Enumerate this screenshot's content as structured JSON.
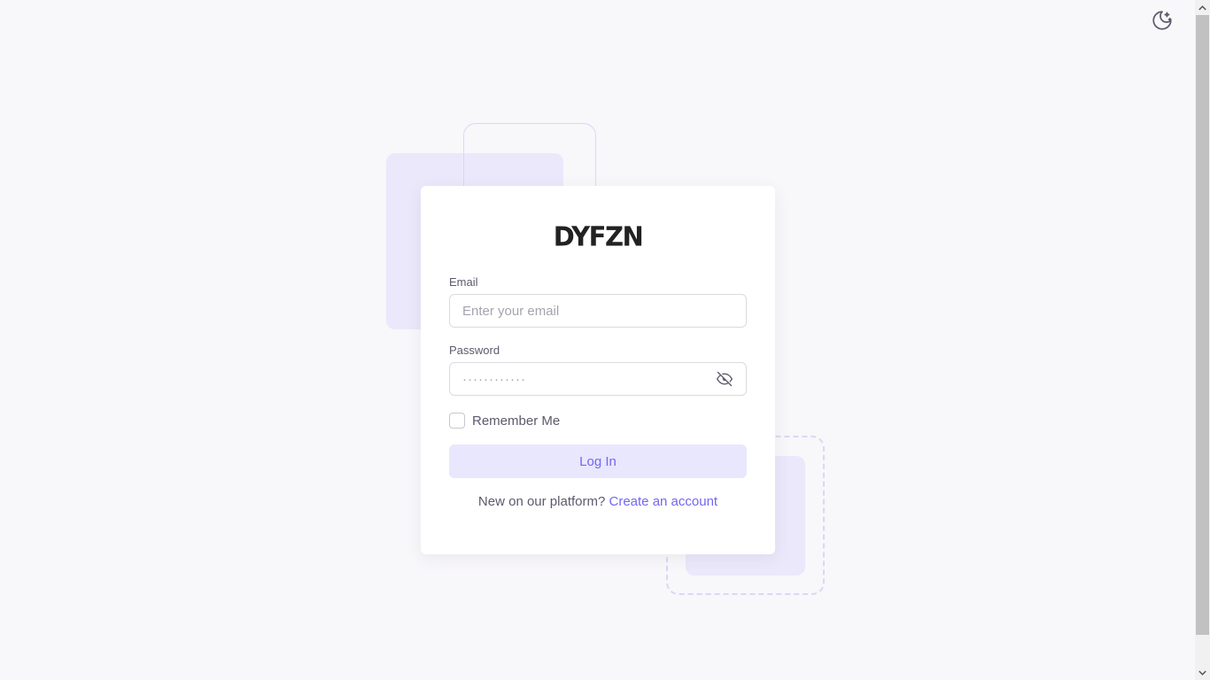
{
  "brand": {
    "logo_text": "DYFZN"
  },
  "theme_toggle": {
    "icon": "moon-stars-icon"
  },
  "login_form": {
    "email_label": "Email",
    "email_placeholder": "Enter your email",
    "email_value": "",
    "password_label": "Password",
    "password_placeholder": "············",
    "password_value": "",
    "password_visibility_icon": "eye-off-icon",
    "remember_label": "Remember Me",
    "remember_checked": false,
    "submit_label": "Log In"
  },
  "signup": {
    "prompt": "New on our platform?",
    "link_label": "Create an account"
  },
  "colors": {
    "primary": "#7367f0",
    "primary_light": "#e9e7fd",
    "background": "#f8f7fa",
    "text": "#5d596c"
  }
}
